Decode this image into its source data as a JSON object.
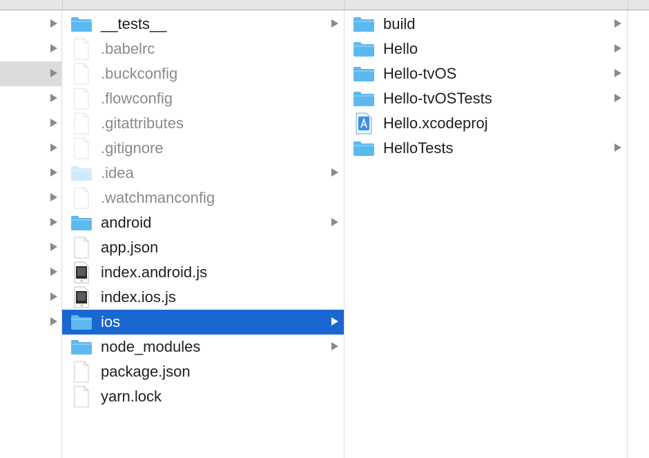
{
  "colors": {
    "selection": "#1a67d2",
    "inactive_selection": "#dcdcdc",
    "folder": "#5cb8f0",
    "hidden_text": "#8a8a8a"
  },
  "column_parent": {
    "rows": [
      {
        "expandable": true,
        "selected": false
      },
      {
        "expandable": true,
        "selected": false
      },
      {
        "expandable": true,
        "selected": true
      },
      {
        "expandable": true,
        "selected": false
      },
      {
        "expandable": true,
        "selected": false
      },
      {
        "expandable": true,
        "selected": false
      },
      {
        "expandable": true,
        "selected": false
      },
      {
        "expandable": true,
        "selected": false
      },
      {
        "expandable": true,
        "selected": false
      },
      {
        "expandable": true,
        "selected": false
      },
      {
        "expandable": true,
        "selected": false
      },
      {
        "expandable": true,
        "selected": false
      },
      {
        "expandable": true,
        "selected": false
      }
    ]
  },
  "column_project": {
    "items": [
      {
        "name": "__tests__",
        "icon": "folder-icon",
        "hidden": false,
        "expandable": true,
        "selected": false
      },
      {
        "name": ".babelrc",
        "icon": "document-icon",
        "hidden": true,
        "expandable": false,
        "selected": false
      },
      {
        "name": ".buckconfig",
        "icon": "document-icon",
        "hidden": true,
        "expandable": false,
        "selected": false
      },
      {
        "name": ".flowconfig",
        "icon": "document-icon",
        "hidden": true,
        "expandable": false,
        "selected": false
      },
      {
        "name": ".gitattributes",
        "icon": "document-icon",
        "hidden": true,
        "expandable": false,
        "selected": false
      },
      {
        "name": ".gitignore",
        "icon": "document-icon",
        "hidden": true,
        "expandable": false,
        "selected": false
      },
      {
        "name": ".idea",
        "icon": "folder-icon",
        "hidden": true,
        "expandable": true,
        "selected": false
      },
      {
        "name": ".watchmanconfig",
        "icon": "document-icon",
        "hidden": true,
        "expandable": false,
        "selected": false
      },
      {
        "name": "android",
        "icon": "folder-icon",
        "hidden": false,
        "expandable": true,
        "selected": false
      },
      {
        "name": "app.json",
        "icon": "document-icon",
        "hidden": false,
        "expandable": false,
        "selected": false
      },
      {
        "name": "index.android.js",
        "icon": "js-file-icon",
        "hidden": false,
        "expandable": false,
        "selected": false
      },
      {
        "name": "index.ios.js",
        "icon": "js-file-icon",
        "hidden": false,
        "expandable": false,
        "selected": false
      },
      {
        "name": "ios",
        "icon": "folder-icon",
        "hidden": false,
        "expandable": true,
        "selected": true
      },
      {
        "name": "node_modules",
        "icon": "folder-icon",
        "hidden": false,
        "expandable": true,
        "selected": false
      },
      {
        "name": "package.json",
        "icon": "document-icon",
        "hidden": false,
        "expandable": false,
        "selected": false
      },
      {
        "name": "yarn.lock",
        "icon": "document-icon",
        "hidden": false,
        "expandable": false,
        "selected": false
      }
    ]
  },
  "column_ios": {
    "items": [
      {
        "name": "build",
        "icon": "folder-icon",
        "hidden": false,
        "expandable": true,
        "selected": false
      },
      {
        "name": "Hello",
        "icon": "folder-icon",
        "hidden": false,
        "expandable": true,
        "selected": false
      },
      {
        "name": "Hello-tvOS",
        "icon": "folder-icon",
        "hidden": false,
        "expandable": true,
        "selected": false
      },
      {
        "name": "Hello-tvOSTests",
        "icon": "folder-icon",
        "hidden": false,
        "expandable": true,
        "selected": false
      },
      {
        "name": "Hello.xcodeproj",
        "icon": "xcodeproj-icon",
        "hidden": false,
        "expandable": false,
        "selected": false
      },
      {
        "name": "HelloTests",
        "icon": "folder-icon",
        "hidden": false,
        "expandable": true,
        "selected": false
      }
    ]
  }
}
